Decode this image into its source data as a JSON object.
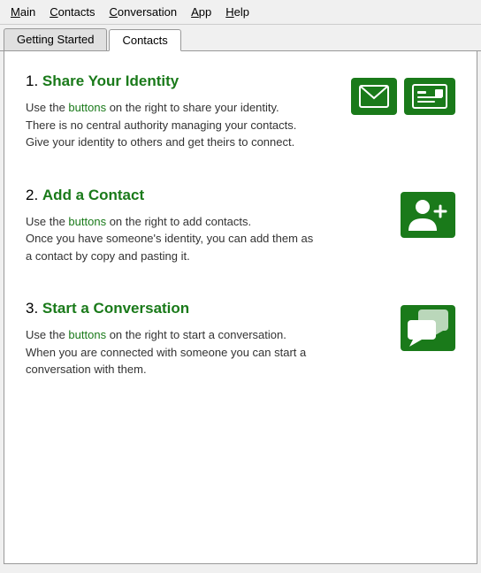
{
  "menubar": {
    "items": [
      {
        "label": "Main",
        "underline_index": 0
      },
      {
        "label": "Contacts",
        "underline_index": 0
      },
      {
        "label": "Conversation",
        "underline_index": 0
      },
      {
        "label": "App",
        "underline_index": 0
      },
      {
        "label": "Help",
        "underline_index": 0
      }
    ]
  },
  "tabs": [
    {
      "label": "Getting Started",
      "active": false
    },
    {
      "label": "Contacts",
      "active": true
    }
  ],
  "sections": [
    {
      "number": "1.",
      "title": "Share Your Identity",
      "description_parts": [
        "Use the ",
        "buttons",
        " on the right to share your identity.\nThere is no central authority managing your contacts.\nGive your identity to others and get theirs to connect."
      ],
      "icons": [
        "email",
        "card"
      ]
    },
    {
      "number": "2.",
      "title": "Add a Contact",
      "description_parts": [
        "Use the ",
        "buttons",
        " on the right to add contacts.\nOnce you have someone's identity, you can add them as\na contact by copy and pasting it."
      ],
      "icons": [
        "add-contact"
      ]
    },
    {
      "number": "3.",
      "title": "Start a Conversation",
      "description_parts": [
        "Use the ",
        "buttons",
        " on the right to start a conversation.\nWhen you are connected with someone you can start a\nconversation with them."
      ],
      "icons": [
        "conversation"
      ]
    }
  ],
  "colors": {
    "green": "#1a7a1a",
    "link_green": "#1a7a1a"
  }
}
